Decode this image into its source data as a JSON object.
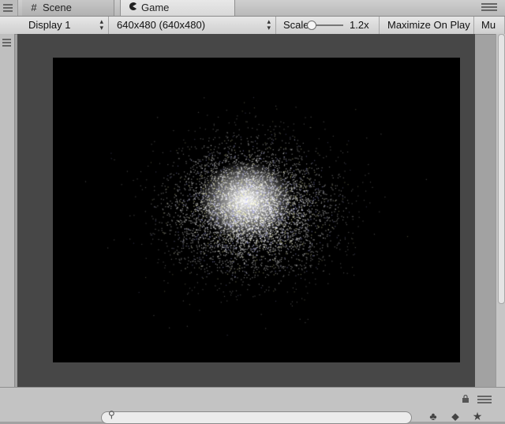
{
  "tabs": [
    {
      "label": "Scene",
      "icon": "grid-icon"
    },
    {
      "label": "Game",
      "icon": "pacman-icon"
    }
  ],
  "toolbar": {
    "display_value": "Display 1",
    "resolution_value": "640x480 (640x480)",
    "scale_label": "Scale",
    "scale_value": "1.2x",
    "maximize_label": "Maximize On Play",
    "mute_label": "Mu"
  },
  "colors": {
    "viewport_bg": "#474747",
    "game_bg": "#000000",
    "particle": "#ffffff"
  }
}
